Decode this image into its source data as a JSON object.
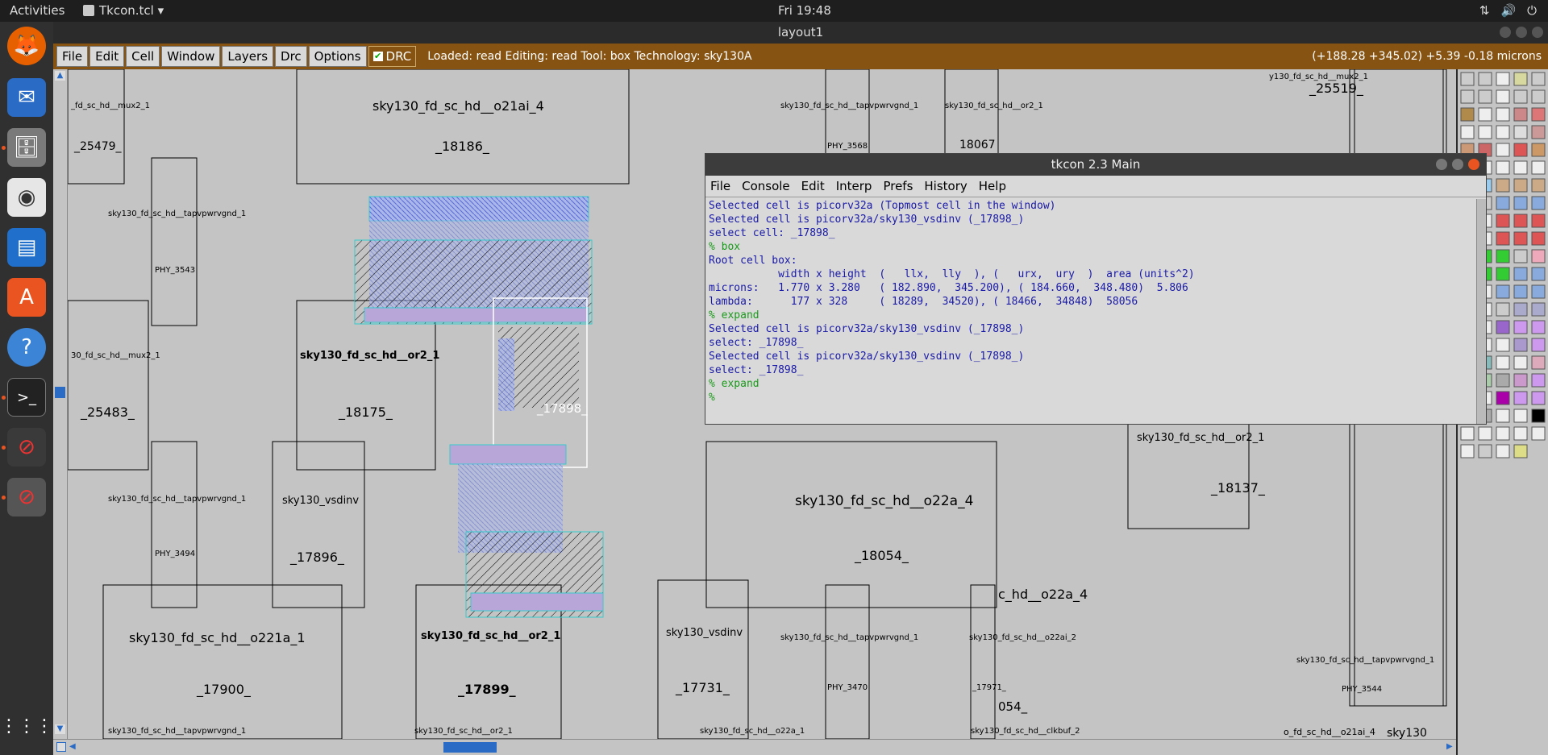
{
  "topbar": {
    "activities": "Activities",
    "app_name": "Tkcon.tcl ▾",
    "clock": "Fri 19:48"
  },
  "window": {
    "title": "layout1"
  },
  "menu": {
    "items": [
      "File",
      "Edit",
      "Cell",
      "Window",
      "Layers",
      "Drc",
      "Options"
    ],
    "drc_label": "DRC",
    "status": "Loaded: read Editing: read Tool: box  Technology: sky130A",
    "coords": "(+188.28 +345.02) +5.39 -0.18 microns"
  },
  "tkcon": {
    "title": "tkcon 2.3 Main",
    "menu": [
      "File",
      "Console",
      "Edit",
      "Interp",
      "Prefs",
      "History",
      "Help"
    ],
    "lines": [
      {
        "t": "Selected cell is picorv32a (Topmost cell in the window)",
        "c": "b"
      },
      {
        "t": "Selected cell is picorv32a/sky130_vsdinv (_17898_)",
        "c": "b"
      },
      {
        "t": "select cell: _17898_",
        "c": "b"
      },
      {
        "t": "% box",
        "c": "g"
      },
      {
        "t": "Root cell box:",
        "c": "b"
      },
      {
        "t": "           width x height  (   llx,  lly  ), (   urx,  ury  )  area (units^2)",
        "c": "b"
      },
      {
        "t": "",
        "c": "b"
      },
      {
        "t": "microns:   1.770 x 3.280   ( 182.890,  345.200), ( 184.660,  348.480)  5.806",
        "c": "b"
      },
      {
        "t": "lambda:      177 x 328     ( 18289,  34520), ( 18466,  34848)  58056",
        "c": "b"
      },
      {
        "t": "% expand",
        "c": "g"
      },
      {
        "t": "Selected cell is picorv32a/sky130_vsdinv (_17898_)",
        "c": "b"
      },
      {
        "t": "select: _17898_",
        "c": "b"
      },
      {
        "t": "Selected cell is picorv32a/sky130_vsdinv (_17898_)",
        "c": "b"
      },
      {
        "t": "select: _17898_",
        "c": "b"
      },
      {
        "t": "% expand",
        "c": "g"
      },
      {
        "t": "%",
        "c": "g"
      }
    ]
  },
  "labels": {
    "o21ai_4": "sky130_fd_sc_hd__o21ai_4",
    "n18186": "_18186_",
    "mux2_1_a": "_fd_sc_hd__mux2_1",
    "n25479": "_25479_",
    "tap1": "sky130_fd_sc_hd__tapvpwrvgnd_1",
    "phy3543": "PHY_3543",
    "mux2_1_b": "30_fd_sc_hd__mux2_1",
    "n25483": "_25483_",
    "or2_1": "sky130_fd_sc_hd__or2_1",
    "n18175": "_18175_",
    "n17898": "_17898_",
    "tap2": "sky130_fd_sc_hd__tapvpwrvgnd_1",
    "phy3494": "PHY_3494",
    "vsdinv": "sky130_vsdinv",
    "n17896": "_17896_",
    "o221a_1": "sky130_fd_sc_hd__o221a_1",
    "n17900": "_17900_",
    "or2_1b": "sky130_fd_sc_hd__or2_1",
    "n17899": "_17899_",
    "vsdinv2": "sky130_vsdinv",
    "n17731": "_17731_",
    "tap_top": "sky130_fd_sc_hd__tapvpwrvgnd_1",
    "phy3568": "PHY_3568",
    "or2_top": "sky130_fd_sc_hd__or2_1",
    "n18067": "18067",
    "o22a_4": "sky130_fd_sc_hd__o22a_4",
    "n18054": "_18054_",
    "o22a_4b": "c_hd__o22a_4",
    "tap3": "sky130_fd_sc_hd__tapvpwrvgnd_1",
    "phy3470": "PHY_3470",
    "o22ai_2": "sky130_fd_sc_hd__o22ai_2",
    "n17971": "_17971_",
    "n054": "054_",
    "or2_r": "sky130_fd_sc_hd__or2_1",
    "n18137": "_18137_",
    "mux_r": "y130_fd_sc_hd__mux2_1",
    "n25519": "_25519_",
    "tap_r": "sky130_fd_sc_hd__tapvpwrvgnd_1",
    "phy3544": "PHY_3544",
    "o21ai_r": "o_fd_sc_hd__o21ai_4",
    "sky130": "sky130",
    "bot1": "sky130_fd_sc_hd__tapvpwrvgnd_1",
    "bot2": "sky130_fd_sc_hd__or2_1",
    "bot3": "sky130_fd_sc_hd__o22a_1",
    "bot4": "sky130_fd_sc_hd__clkbuf_2"
  }
}
